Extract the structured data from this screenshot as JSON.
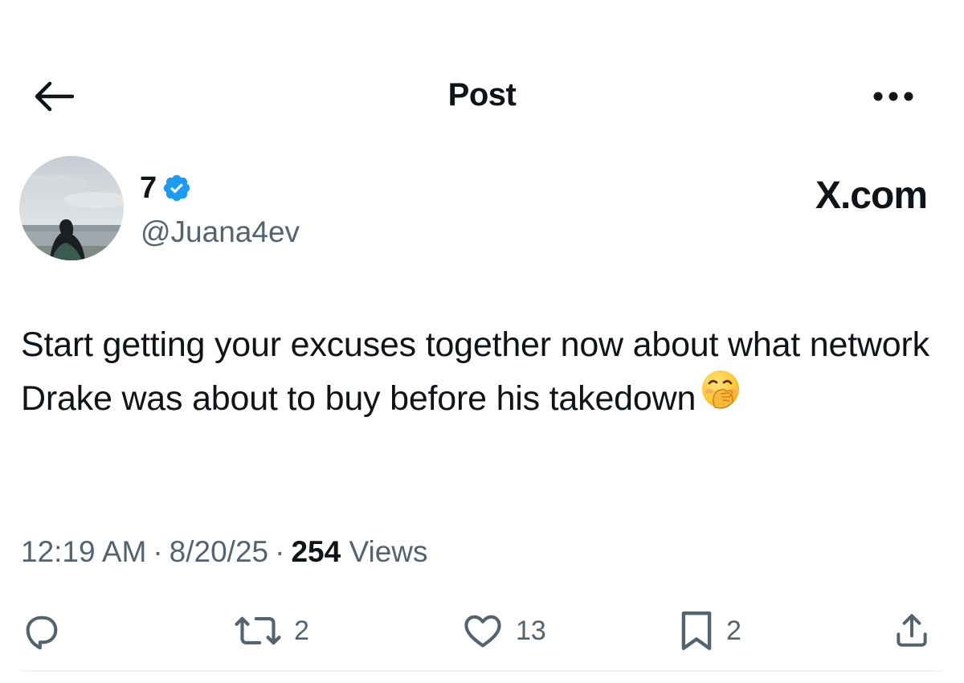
{
  "header": {
    "title": "Post",
    "back_icon": "arrow-left-icon",
    "more_icon": "more-horizontal-icon"
  },
  "author": {
    "display_name": "7",
    "verified": true,
    "verified_color": "#1d9bf0",
    "handle": "@Juana4ev",
    "avatar_icon": "profile-photo"
  },
  "brand": {
    "text": "X.com"
  },
  "tweet": {
    "text": "Start getting your excuses together now about what network Drake was about to buy before his takedown",
    "emoji": "🤭"
  },
  "meta": {
    "time": "12:19 AM",
    "date": "8/20/25",
    "separator": "·",
    "views_count": "254",
    "views_label": "Views"
  },
  "actions": {
    "reply": {
      "icon": "reply-icon",
      "count": ""
    },
    "retweet": {
      "icon": "retweet-icon",
      "count": "2"
    },
    "like": {
      "icon": "heart-icon",
      "count": "13"
    },
    "bookmark": {
      "icon": "bookmark-icon",
      "count": "2"
    },
    "share": {
      "icon": "share-icon",
      "count": ""
    }
  },
  "colors": {
    "text_primary": "#0f1419",
    "text_secondary": "#536471",
    "divider": "#eff3f4",
    "accent": "#1d9bf0"
  }
}
